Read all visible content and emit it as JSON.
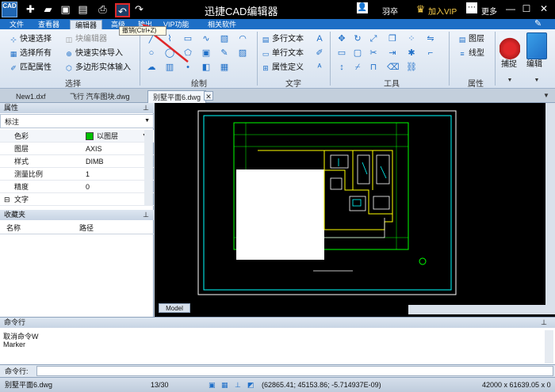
{
  "titlebar": {
    "app_title": "迅捷CAD编辑器",
    "logo_text": "CAD",
    "user": "羽卒",
    "vip": "加入VIP",
    "more": "更多"
  },
  "tabs": [
    "文件",
    "查看器",
    "编辑器",
    "高级",
    "输出",
    "VIP功能",
    "相关软件"
  ],
  "tooltip": "撤销(Ctrl+Z)",
  "ribbon": {
    "select": {
      "label": "选择",
      "items": [
        "快速选择",
        "选择所有",
        "匹配属性",
        "块编辑器",
        "快速实体导入",
        "多边形实体输入"
      ]
    },
    "draw": {
      "label": "绘制"
    },
    "text": {
      "label": "文字",
      "items": [
        "多行文本",
        "单行文本",
        "属性定义"
      ]
    },
    "tools": {
      "label": "工具"
    },
    "props": {
      "label": "属性",
      "items": [
        "图层",
        "线型"
      ]
    },
    "snap": "捕捉",
    "edit": "编辑"
  },
  "doc_tabs": [
    "New1.dxf",
    "飞行 汽车图块.dwg",
    "别墅平面6.dwg"
  ],
  "properties_panel": {
    "title": "属性",
    "selector": "标注",
    "rows": [
      {
        "key": "色彩",
        "value": "以图层"
      },
      {
        "key": "图层",
        "value": "AXIS"
      },
      {
        "key": "样式",
        "value": "DIMB"
      },
      {
        "key": "测量比例",
        "value": "1"
      },
      {
        "key": "精度",
        "value": "0"
      }
    ],
    "section": "文字"
  },
  "favorites_panel": {
    "title": "收藏夹",
    "col_name": "名称",
    "col_path": "路径"
  },
  "model_tab": "Model",
  "command": {
    "title": "命令行",
    "lines": [
      "取消命令W",
      "Marker"
    ],
    "input_label": "命令行:"
  },
  "status": {
    "file": "别墅平面6.dwg",
    "page": "13/30",
    "coords": "(62865.41; 45153.86; -5.714937E-09)",
    "size": "42000 x 61639.05 x 0"
  },
  "colors": {
    "title_bg": "#000000",
    "tab_bg": "#1e6fc6",
    "vip": "#ffd24a",
    "undo_highlight": "#e0282a",
    "cad_green": "#00ff00",
    "cad_cyan": "#00ffff",
    "cad_yellow": "#ffff00",
    "cad_white": "#ffffff"
  }
}
